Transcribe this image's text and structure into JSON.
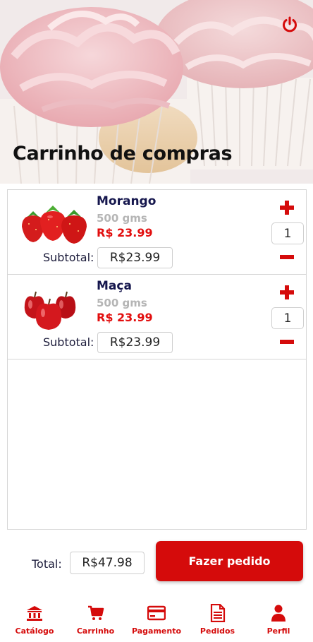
{
  "header": {
    "title": "Carrinho de compras",
    "power_icon": "power-icon"
  },
  "cart": {
    "items": [
      {
        "name": "Morango",
        "weight": "500 gms",
        "price": "R$ 23.99",
        "subtotal_label": "Subtotal:",
        "subtotal": "R$23.99",
        "quantity": "1",
        "image": "strawberries"
      },
      {
        "name": "Maça",
        "weight": "500 gms",
        "price": "R$ 23.99",
        "subtotal_label": "Subtotal:",
        "subtotal": "R$23.99",
        "quantity": "1",
        "image": "apples"
      }
    ]
  },
  "footer": {
    "total_label": "Total:",
    "total_value": "R$47.98",
    "order_button": "Fazer pedido"
  },
  "nav": {
    "items": [
      {
        "label": "Catálogo",
        "icon": "bank-icon"
      },
      {
        "label": "Carrinho",
        "icon": "cart-icon"
      },
      {
        "label": "Pagamento",
        "icon": "credit-card-icon"
      },
      {
        "label": "Pedidos",
        "icon": "document-icon"
      },
      {
        "label": "Perfil",
        "icon": "user-icon"
      }
    ]
  },
  "colors": {
    "accent": "#d50b0b",
    "price": "#e20e0e",
    "product_name": "#15164d",
    "muted": "#b5b5b5"
  }
}
